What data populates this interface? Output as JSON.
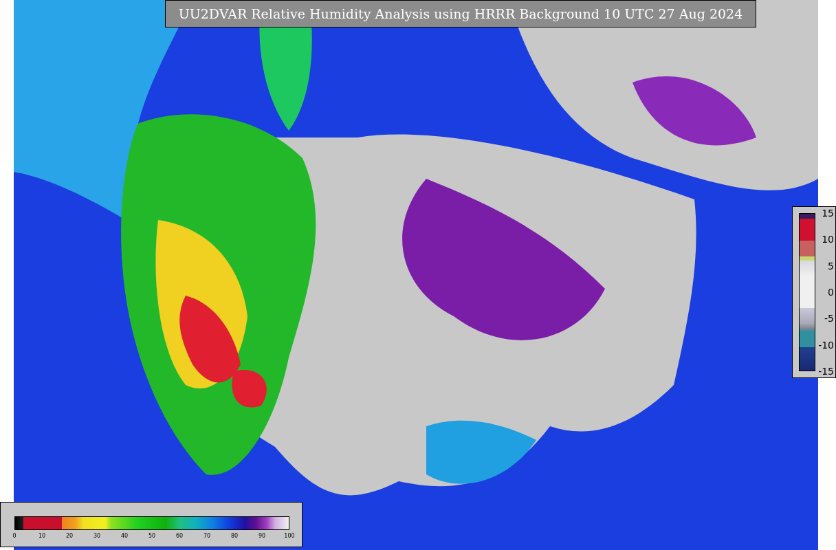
{
  "title": "UU2DVAR Relative Humidity Analysis using HRRR Background 10 UTC 27 Aug 2024",
  "humidity_legend": {
    "ticks": [
      "0",
      "10",
      "20",
      "30",
      "40",
      "50",
      "60",
      "70",
      "80",
      "90",
      "100"
    ]
  },
  "difference_legend": {
    "ticks": [
      "15",
      "10",
      "5",
      "0",
      "-5",
      "-10",
      "-15"
    ]
  }
}
